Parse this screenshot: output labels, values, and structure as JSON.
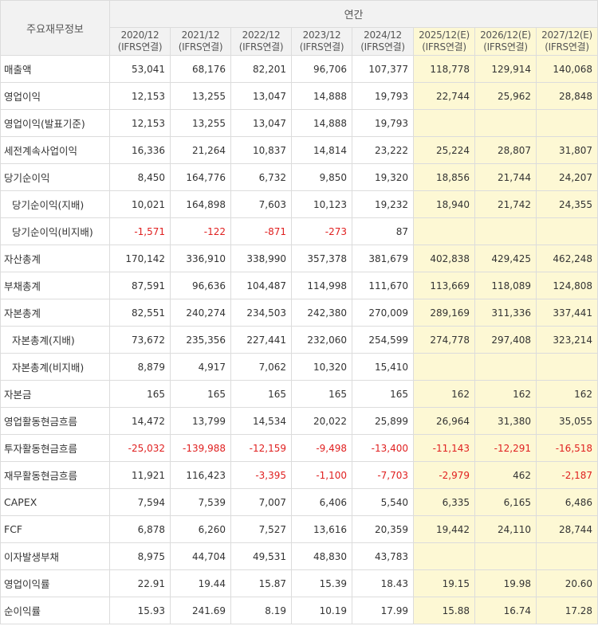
{
  "table": {
    "corner_label": "주요재무정보",
    "annual_label": "연간",
    "columns": [
      {
        "period": "2020/12",
        "basis": "(IFRS연결)",
        "estimate": false
      },
      {
        "period": "2021/12",
        "basis": "(IFRS연결)",
        "estimate": false
      },
      {
        "period": "2022/12",
        "basis": "(IFRS연결)",
        "estimate": false
      },
      {
        "period": "2023/12",
        "basis": "(IFRS연결)",
        "estimate": false
      },
      {
        "period": "2024/12",
        "basis": "(IFRS연결)",
        "estimate": false
      },
      {
        "period": "2025/12(E)",
        "basis": "(IFRS연결)",
        "estimate": true
      },
      {
        "period": "2026/12(E)",
        "basis": "(IFRS연결)",
        "estimate": true
      },
      {
        "period": "2027/12(E)",
        "basis": "(IFRS연결)",
        "estimate": true
      }
    ],
    "rows": [
      {
        "label": "매출액",
        "sub": false,
        "values": [
          "53,041",
          "68,176",
          "82,201",
          "96,706",
          "107,377",
          "118,778",
          "129,914",
          "140,068"
        ]
      },
      {
        "label": "영업이익",
        "sub": false,
        "values": [
          "12,153",
          "13,255",
          "13,047",
          "14,888",
          "19,793",
          "22,744",
          "25,962",
          "28,848"
        ]
      },
      {
        "label": "영업이익(발표기준)",
        "sub": false,
        "values": [
          "12,153",
          "13,255",
          "13,047",
          "14,888",
          "19,793",
          "",
          "",
          ""
        ]
      },
      {
        "label": "세전계속사업이익",
        "sub": false,
        "values": [
          "16,336",
          "21,264",
          "10,837",
          "14,814",
          "23,222",
          "25,224",
          "28,807",
          "31,807"
        ]
      },
      {
        "label": "당기순이익",
        "sub": false,
        "values": [
          "8,450",
          "164,776",
          "6,732",
          "9,850",
          "19,320",
          "18,856",
          "21,744",
          "24,207"
        ]
      },
      {
        "label": "당기순이익(지배)",
        "sub": true,
        "values": [
          "10,021",
          "164,898",
          "7,603",
          "10,123",
          "19,232",
          "18,940",
          "21,742",
          "24,355"
        ]
      },
      {
        "label": "당기순이익(비지배)",
        "sub": true,
        "values": [
          "-1,571",
          "-122",
          "-871",
          "-273",
          "87",
          "",
          "",
          ""
        ]
      },
      {
        "label": "자산총계",
        "sub": false,
        "values": [
          "170,142",
          "336,910",
          "338,990",
          "357,378",
          "381,679",
          "402,838",
          "429,425",
          "462,248"
        ]
      },
      {
        "label": "부채총계",
        "sub": false,
        "values": [
          "87,591",
          "96,636",
          "104,487",
          "114,998",
          "111,670",
          "113,669",
          "118,089",
          "124,808"
        ]
      },
      {
        "label": "자본총계",
        "sub": false,
        "values": [
          "82,551",
          "240,274",
          "234,503",
          "242,380",
          "270,009",
          "289,169",
          "311,336",
          "337,441"
        ]
      },
      {
        "label": "자본총계(지배)",
        "sub": true,
        "values": [
          "73,672",
          "235,356",
          "227,441",
          "232,060",
          "254,599",
          "274,778",
          "297,408",
          "323,214"
        ]
      },
      {
        "label": "자본총계(비지배)",
        "sub": true,
        "values": [
          "8,879",
          "4,917",
          "7,062",
          "10,320",
          "15,410",
          "",
          "",
          ""
        ]
      },
      {
        "label": "자본금",
        "sub": false,
        "values": [
          "165",
          "165",
          "165",
          "165",
          "165",
          "162",
          "162",
          "162"
        ]
      },
      {
        "label": "영업활동현금흐름",
        "sub": false,
        "values": [
          "14,472",
          "13,799",
          "14,534",
          "20,022",
          "25,899",
          "26,964",
          "31,380",
          "35,055"
        ]
      },
      {
        "label": "투자활동현금흐름",
        "sub": false,
        "values": [
          "-25,032",
          "-139,988",
          "-12,159",
          "-9,498",
          "-13,400",
          "-11,143",
          "-12,291",
          "-16,518"
        ]
      },
      {
        "label": "재무활동현금흐름",
        "sub": false,
        "values": [
          "11,921",
          "116,423",
          "-3,395",
          "-1,100",
          "-7,703",
          "-2,979",
          "462",
          "-2,187"
        ]
      },
      {
        "label": "CAPEX",
        "sub": false,
        "values": [
          "7,594",
          "7,539",
          "7,007",
          "6,406",
          "5,540",
          "6,335",
          "6,165",
          "6,486"
        ]
      },
      {
        "label": "FCF",
        "sub": false,
        "values": [
          "6,878",
          "6,260",
          "7,527",
          "13,616",
          "20,359",
          "19,442",
          "24,110",
          "28,744"
        ]
      },
      {
        "label": "이자발생부채",
        "sub": false,
        "values": [
          "8,975",
          "44,704",
          "49,531",
          "48,830",
          "43,783",
          "",
          "",
          ""
        ]
      },
      {
        "label": "영업이익률",
        "sub": false,
        "values": [
          "22.91",
          "19.44",
          "15.87",
          "15.39",
          "18.43",
          "19.15",
          "19.98",
          "20.60"
        ]
      },
      {
        "label": "순이익률",
        "sub": false,
        "values": [
          "15.93",
          "241.69",
          "8.19",
          "10.19",
          "17.99",
          "15.88",
          "16.74",
          "17.28"
        ]
      }
    ],
    "colors": {
      "estimate_bg": "#fdf8d4",
      "negative": "#e02020",
      "header_bg": "#f2f2f2"
    }
  }
}
